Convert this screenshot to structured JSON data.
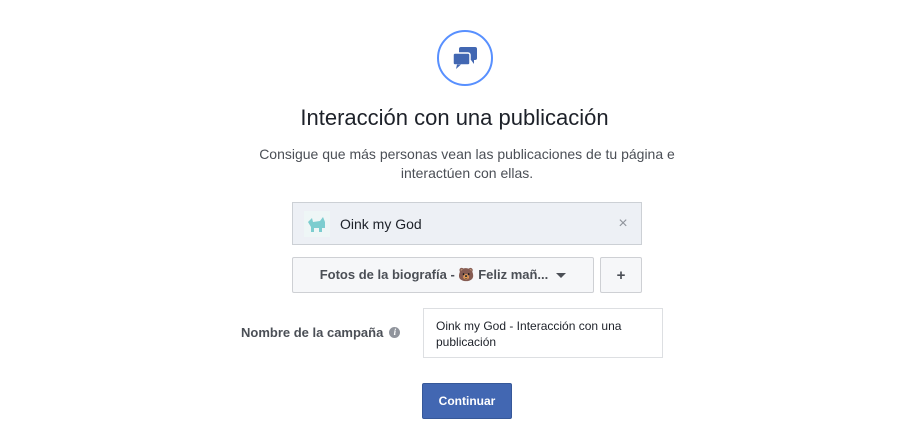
{
  "header": {
    "icon": "chat-bubbles-icon",
    "title": "Interacción con una publicación",
    "subtitle": "Consigue que más personas vean las publicaciones de tu página e interactúen con ellas."
  },
  "page_selector": {
    "icon": "page-thumbnail-icon",
    "name": "Oink my God",
    "clear_glyph": "×"
  },
  "post_selector": {
    "label": "Fotos de la biografía - 🐻 Feliz mañ...",
    "add_glyph": "+"
  },
  "campaign": {
    "label": "Nombre de la campaña",
    "info_glyph": "i",
    "value": "Oink my God - Interacción con una publicación"
  },
  "actions": {
    "continue_label": "Continuar"
  },
  "colors": {
    "accent": "#5890ff",
    "primary_button": "#4267b2",
    "selector_bg": "#edf0f5"
  }
}
